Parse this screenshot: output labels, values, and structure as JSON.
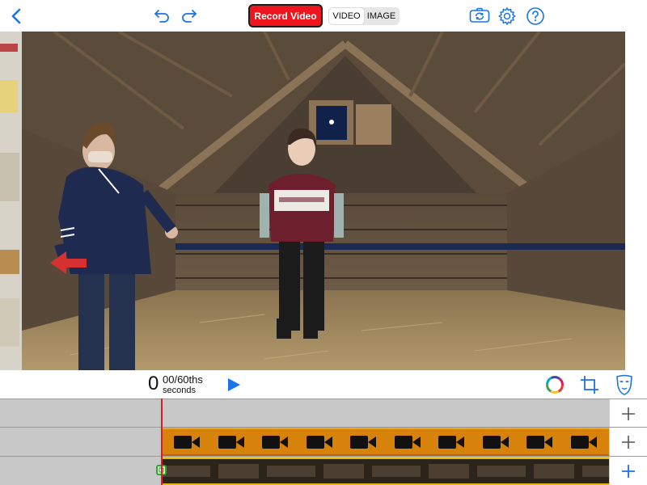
{
  "toolbar": {
    "record_label": "Record Video",
    "mode_options": [
      "VIDEO",
      "IMAGE"
    ],
    "mode_selected": "VIDEO",
    "accent_color": "#1a73e8",
    "record_color": "#f0151c",
    "icons": [
      "back-chevron-icon",
      "undo-icon",
      "redo-icon",
      "flip-camera-icon",
      "settings-gear-icon",
      "help-icon"
    ]
  },
  "playback": {
    "seconds": "0",
    "fraction": "00/60ths",
    "unit": "seconds",
    "icons": [
      "play-icon",
      "color-wheel-icon",
      "crop-icon",
      "mask-icon"
    ]
  },
  "timeline": {
    "tracks": [
      {
        "name": "empty-track",
        "has_clip": false
      },
      {
        "name": "video-track",
        "has_clip": true,
        "clip_color": "#d6820b",
        "clip_icon": "video-camera-icon"
      },
      {
        "name": "background-track",
        "has_clip": true,
        "clip_color": "#e3b610"
      }
    ],
    "add_icons": [
      "plus-icon",
      "plus-icon",
      "plus-icon"
    ],
    "playhead_color": "#e01b1b"
  }
}
